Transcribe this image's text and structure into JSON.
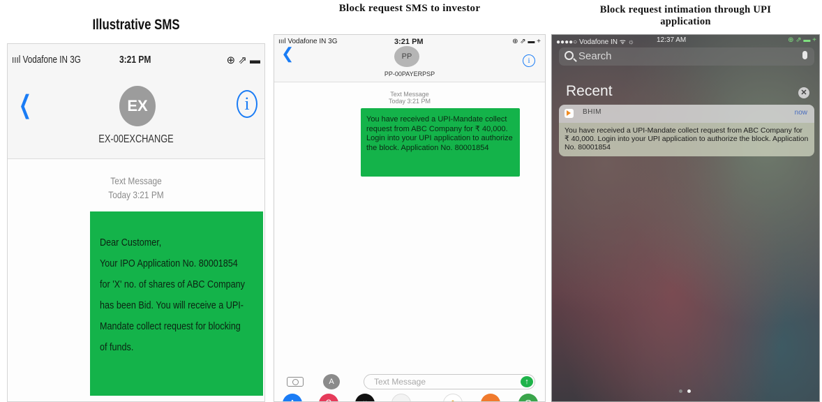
{
  "captions": {
    "left": "Illustrative SMS",
    "middle": "Block request SMS to investor",
    "right_line1": "Block request intimation through UPI",
    "right_line2": "application"
  },
  "panel1": {
    "status": {
      "carrier": "ıııl Vodafone IN  3G",
      "time": "3:21 PM",
      "right_icons": "⊕ ⇗ ▬"
    },
    "back_icon": "chevron-left-icon",
    "info_icon": "info-icon",
    "avatar_initials": "EX",
    "sender": "EX-00EXCHANGE",
    "meta_line1": "Text Message",
    "meta_line2": "Today 3:21 PM",
    "message_lines": [
      "Dear Customer,",
      "Your IPO Application No. 80001854",
      "for 'X' no. of shares of ABC Company",
      "has been Bid. You will receive a UPI-",
      "Mandate collect request for blocking",
      "of funds."
    ],
    "bubble_color": "#14b34a"
  },
  "panel2": {
    "status": {
      "carrier": "ıııl Vodafone IN  3G",
      "time": "3:21 PM",
      "right_icons": "⊕ ⇗ ▬ +"
    },
    "avatar_initials": "PP",
    "sender": "PP-00PAYERPSP",
    "meta_line1": "Text Message",
    "meta_line2": "Today 3:21 PM",
    "message": "You have received a UPI-Mandate collect request from ABC Company for ₹ 40,000. Login into your UPI application to authorize the block. Application No. 80001854",
    "input_placeholder": "Text Message",
    "dock_icons": [
      "app-store-icon",
      "search-app-icon",
      "digital-touch-icon",
      "music-icon",
      "photos-icon",
      "game-icon",
      "maps-icon"
    ]
  },
  "panel3": {
    "status": {
      "carrier": "●●●●○ Vodafone IN ᯤ ☼",
      "time": "12:37 AM",
      "right_icons": "⊕ ⇗ ▬ +"
    },
    "search_placeholder": "Search",
    "recent_title": "Recent",
    "clear_label": "✕",
    "app_name": "BHIM",
    "time_label": "now",
    "notification": "You have received a UPI-Mandate collect request from ABC Company for ₹ 40,000. Login into your UPI application to authorize the block. Application No. 80001854"
  }
}
